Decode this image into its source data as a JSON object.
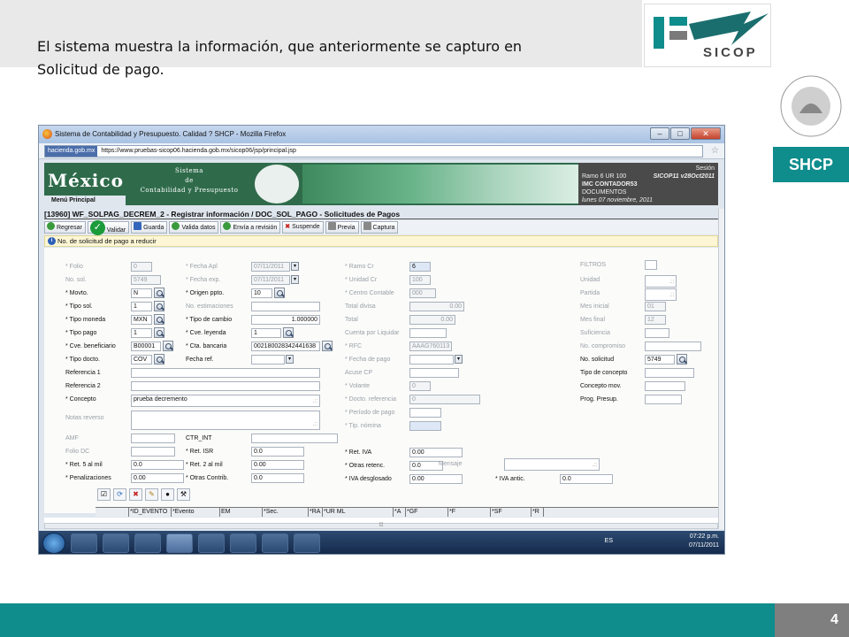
{
  "slide": {
    "caption_line1": "El sistema muestra la información, que anteriormente  se capturo  en",
    "caption_line2": "Solicitud  de  pago.",
    "logo_text": "SICOP",
    "brand": "SHCP",
    "page_number": "4",
    "colors": {
      "teal": "#0f8c8c",
      "gray": "#7f7f7f",
      "banner_green": "#2f6b4b"
    }
  },
  "browser": {
    "window_title": "Sistema de Contabilidad y Presupuesto. Calidad ? SHCP - Mozilla Firefox",
    "site_badge": "hacienda.gob.mx",
    "url": "https://www.pruebas-sicop06.hacienda.gob.mx/sicop06/jsp/principal.jsp"
  },
  "banner": {
    "brand": "México",
    "menu": "Menú Principal",
    "system_l1": "Sistema",
    "system_l2": "de",
    "system_l3": "Contabilidad y Presupuesto",
    "session_label": "Sesión",
    "ramo": "Ramo  6  UR 100",
    "version": "SICOP11  v28Oct2011",
    "user": "IMC CONTADOR53",
    "docs": "DOCUMENTOS",
    "date": "lunes 07 noviembre, 2011"
  },
  "form_title": "[13960]  WF_SOLPAG_DECREM_2 - Registrar información / DOC_SOL_PAGO - Solicitudes de Pagos",
  "toolbar": {
    "regresar": "Regresar",
    "validar": "Validar",
    "guarda": "Guarda",
    "valida_datos": "Valida datos",
    "envia": "Envía a revisión",
    "suspende": "Suspende",
    "previa": "Previa",
    "captura": "Captura"
  },
  "info_message": "No. de solicitud de pago a reducir",
  "labels": {
    "folio": "* Folio",
    "no_sol": "No. sol.",
    "movto": "* Movto.",
    "tipo_sol": "* Tipo sol.",
    "tipo_moneda": "* Tipo moneda",
    "tipo_pago": "* Tipo pago",
    "cve_benef": "* Cve. beneficiario",
    "tipo_docto": "* Tipo docto.",
    "ref1": "Referencia 1",
    "ref2": "Referencia 2",
    "concepto": "* Concepto",
    "notas": "Notas reverso",
    "amf": "AMF",
    "folio_dc": "Folio DC",
    "ret5": "* Ret. 5 al mil",
    "penal": "* Penalizaciones",
    "fecha_apl": "* Fecha Apl",
    "fecha_exp": "* Fecha exp.",
    "origen": "* Origen ppto.",
    "no_estim": "No. estimaciones",
    "tipo_cambio": "* Tipo de cambio",
    "cve_leyenda": "* Cve. leyenda",
    "cta_banc": "* Cta. bancaria",
    "fecha_ref": "Fecha ref.",
    "ctr_int": "CTR_INT",
    "ret_isr": "* Ret. ISR",
    "ret2": "* Ret. 2 al mil",
    "otras_contrib": "* Otras Contrib.",
    "ramo_cr": "* Ramo Cr",
    "unidad_cr": "* Unidad Cr",
    "centro": "* Centro Contable",
    "total_divisa": "Total divisa",
    "total": "Total",
    "cuenta_liq": "Cuenta por Liquidar",
    "rfc": "* RFC",
    "fecha_pago": "* Fecha de pago",
    "acuse": "Acuse CP",
    "volante": "* Volante",
    "docto_ref": "* Docto. referencia",
    "periodo": "* Período de pago",
    "tip_nomina": "* Tip. nómina",
    "ret_iva": "* Ret. IVA",
    "otras_ret": "* Otras retenc.",
    "iva_desg": "* IVA desglosado",
    "mensaje": "Mensaje",
    "iva_antic": "* IVA antic.",
    "filtros": "FILTROS",
    "unidad": "Unidad",
    "partida": "Partida",
    "mes_ini": "Mes inicial",
    "mes_fin": "Mes final",
    "suficiencia": "Suficiencia",
    "no_comp": "No. compromiso",
    "no_solic": "No. solicitud",
    "tipo_concepto": "Tipo de concepto",
    "concepto_mov": "Concepto mov.",
    "prog_presup": "Prog. Presup."
  },
  "values": {
    "folio": "0",
    "no_sol": "5749",
    "movto": "N",
    "tipo_sol": "1",
    "tipo_moneda": "MXN",
    "tipo_pago": "1",
    "cve_benef": "B00001",
    "tipo_docto": "COV",
    "concepto": "prueba  decremento",
    "ret5": "0.0",
    "penal": "0.00",
    "fecha_apl": "07/11/2011",
    "fecha_exp": "07/11/2011",
    "origen": "10",
    "tipo_cambio": "1.000000",
    "cve_leyenda": "1",
    "cta_banc": "002180028342441638",
    "ret_isr": "0.0",
    "ret2": "0.00",
    "otras_contrib": "0.0",
    "ramo_cr": "6",
    "unidad_cr": "100",
    "centro": "000",
    "total_divisa": "0.00",
    "total": "0.00",
    "rfc": "AAAG760113",
    "volante": "0",
    "docto_ref": "0",
    "ret_iva": "0.00",
    "otras_ret": "0.0",
    "iva_desg": "0.00",
    "iva_antic": "0.0",
    "mes_ini": "01",
    "mes_fin": "12",
    "no_solic": "5749"
  },
  "grid_columns": [
    "",
    "*ID_EVENTO",
    "*Evento",
    "EM",
    "*Sec.",
    "*RA",
    "*UR ML",
    "*A",
    "*GF",
    "*F",
    "*SF",
    "*R"
  ],
  "tray": {
    "lang": "ES",
    "time": "07:22 p.m.",
    "date": "07/11/2011"
  }
}
